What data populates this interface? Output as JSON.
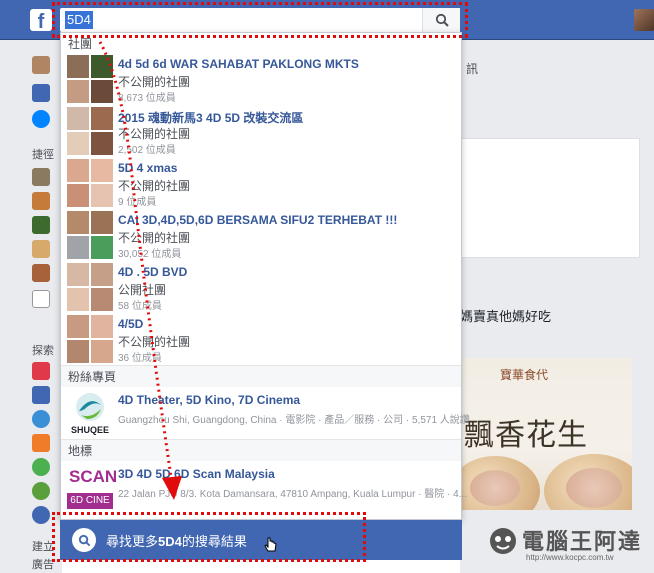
{
  "search": {
    "value": "5D4"
  },
  "sections": {
    "groups": "社團",
    "pages": "粉絲專頁",
    "places": "地標"
  },
  "groups": [
    {
      "title": "4d 5d 6d WAR SAHABAT PAKLONG MKTS",
      "privacy": "不公開的社團",
      "members": "8,673 位成員"
    },
    {
      "title": "2015 魂動新馬3 4D 5D 改裝交流區",
      "privacy": "不公開的社團",
      "members": "2,502 位成員"
    },
    {
      "title": "5D 4 xmas",
      "privacy": "不公開的社團",
      "members": "9 位成員"
    },
    {
      "title": "CAI 3D,4D,5D,6D BERSAMA SIFU2 TERHEBAT !!!",
      "privacy": "不公開的社團",
      "members": "30,052 位成員"
    },
    {
      "title": "4D . 5D BVD",
      "privacy": "公開社團",
      "members": "58 位成員"
    },
    {
      "title": "4/5D",
      "privacy": "不公開的社團",
      "members": "36 位成員"
    }
  ],
  "page_result": {
    "title": "4D Theater, 5D Kino, 7D Cinema",
    "meta": "Guangzhou Shi, Guangdong, China · 電影院 · 產品／服務 · 公司 · 5,571 人說讚",
    "logo_text": "SHUQEE"
  },
  "place_result": {
    "title": "3D 4D 5D 6D Scan Malaysia",
    "meta": "22 Jalan PJU 8/3. Kota Damansara, 47810 Ampang, Kuala Lumpur · 醫院 · 4...",
    "logo_top": "SCAN",
    "logo_bottom": "6D CINE"
  },
  "more_results": {
    "prefix": "尋找更多",
    "query": "5D4",
    "suffix": "的搜尋結果"
  },
  "background": {
    "sidebar_labels": [
      "捷徑",
      "探索",
      "建立",
      "廣告"
    ],
    "right_label_1": "訊",
    "right_text": "媽賣真他媽好吃",
    "food_title": "飄香花生",
    "food_brand": "寶華食代"
  },
  "watermark": {
    "text": "電腦王阿達",
    "url": "http://www.kocpc.com.tw"
  },
  "colors": {
    "fb_blue": "#4267b2",
    "link": "#365899",
    "annotation": "#e10b0b"
  }
}
